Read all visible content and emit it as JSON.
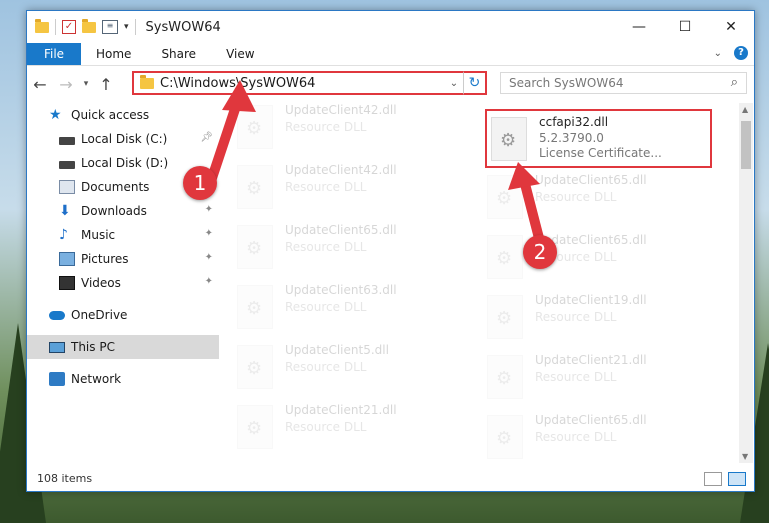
{
  "window": {
    "title": "SysWOW64",
    "controls": [
      "minimize-icon",
      "maximize-icon",
      "close-icon"
    ]
  },
  "ribbon": {
    "file_tab": "File",
    "tabs": [
      "Home",
      "Share",
      "View"
    ],
    "help": "?"
  },
  "address": {
    "path": "C:\\Windows\\SysWOW64",
    "search_placeholder": "Search SysWOW64"
  },
  "nav_pane": {
    "items": [
      {
        "label": "Quick access",
        "icon": "star-icon",
        "pinned": false
      },
      {
        "label": "Local Disk (C:)",
        "icon": "drive-icon",
        "pinned": true
      },
      {
        "label": "Local Disk (D:)",
        "icon": "drive-icon",
        "pinned": false
      },
      {
        "label": "Documents",
        "icon": "documents-icon",
        "pinned": true
      },
      {
        "label": "Downloads",
        "icon": "downloads-icon",
        "pinned": true
      },
      {
        "label": "Music",
        "icon": "music-icon",
        "pinned": true
      },
      {
        "label": "Pictures",
        "icon": "pictures-icon",
        "pinned": true
      },
      {
        "label": "Videos",
        "icon": "videos-icon",
        "pinned": true
      },
      {
        "label": "OneDrive",
        "icon": "onedrive-icon",
        "pinned": false
      },
      {
        "label": "This PC",
        "icon": "pc-icon",
        "pinned": false,
        "selected": true
      },
      {
        "label": "Network",
        "icon": "network-icon",
        "pinned": false
      }
    ]
  },
  "files": [
    {
      "name": "UpdateClient42.dll",
      "type": "Resource DLL"
    },
    {
      "name": "ccfapi32.dll",
      "version": "5.2.3790.0",
      "type": "License Certificate...",
      "highlighted": true
    },
    {
      "name": "UpdateClient42.dll",
      "type": "Resource DLL"
    },
    {
      "name": "UpdateClient65.dll",
      "type": "Resource DLL"
    },
    {
      "name": "UpdateClient65.dll",
      "type": "Resource DLL"
    },
    {
      "name": "UpdateClient65.dll",
      "type": "Resource DLL"
    },
    {
      "name": "UpdateClient63.dll",
      "type": "Resource DLL"
    },
    {
      "name": "UpdateClient19.dll",
      "type": "Resource DLL"
    },
    {
      "name": "UpdateClient5.dll",
      "type": "Resource DLL"
    },
    {
      "name": "UpdateClient21.dll",
      "type": "Resource DLL"
    },
    {
      "name": "UpdateClient21.dll",
      "type": "Resource DLL"
    },
    {
      "name": "UpdateClient65.dll",
      "type": "Resource DLL"
    }
  ],
  "status": {
    "item_count": "108 items"
  },
  "annotations": {
    "step1": "1",
    "step2": "2",
    "color": "#e0373d"
  }
}
